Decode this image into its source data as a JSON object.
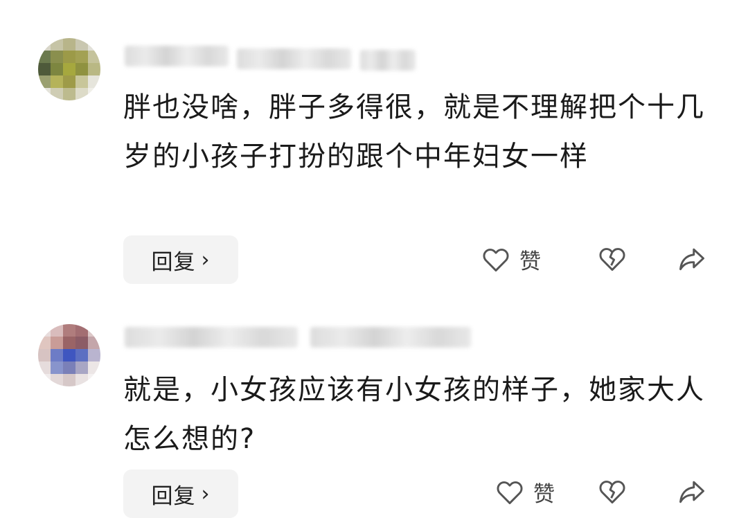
{
  "comments": [
    {
      "text": "胖也没啥，胖子多得很，就是不理解把个十几岁的小孩子打扮的跟个中年妇女一样",
      "reply_label": "回复",
      "reply_chevron": "›",
      "like_label": "赞",
      "icons": [
        "heart-outline-icon",
        "broken-heart-icon",
        "share-arrow-icon"
      ]
    },
    {
      "text": "就是，小女孩应该有小女孩的样子，她家大人怎么想的?",
      "reply_label": "回复",
      "reply_chevron": "›",
      "like_label": "赞",
      "icons": [
        "heart-outline-icon",
        "broken-heart-icon",
        "share-arrow-icon"
      ]
    }
  ],
  "colors": {
    "text": "#1a1a1a",
    "button_bg": "#f3f3f3",
    "icon": "#555555"
  }
}
